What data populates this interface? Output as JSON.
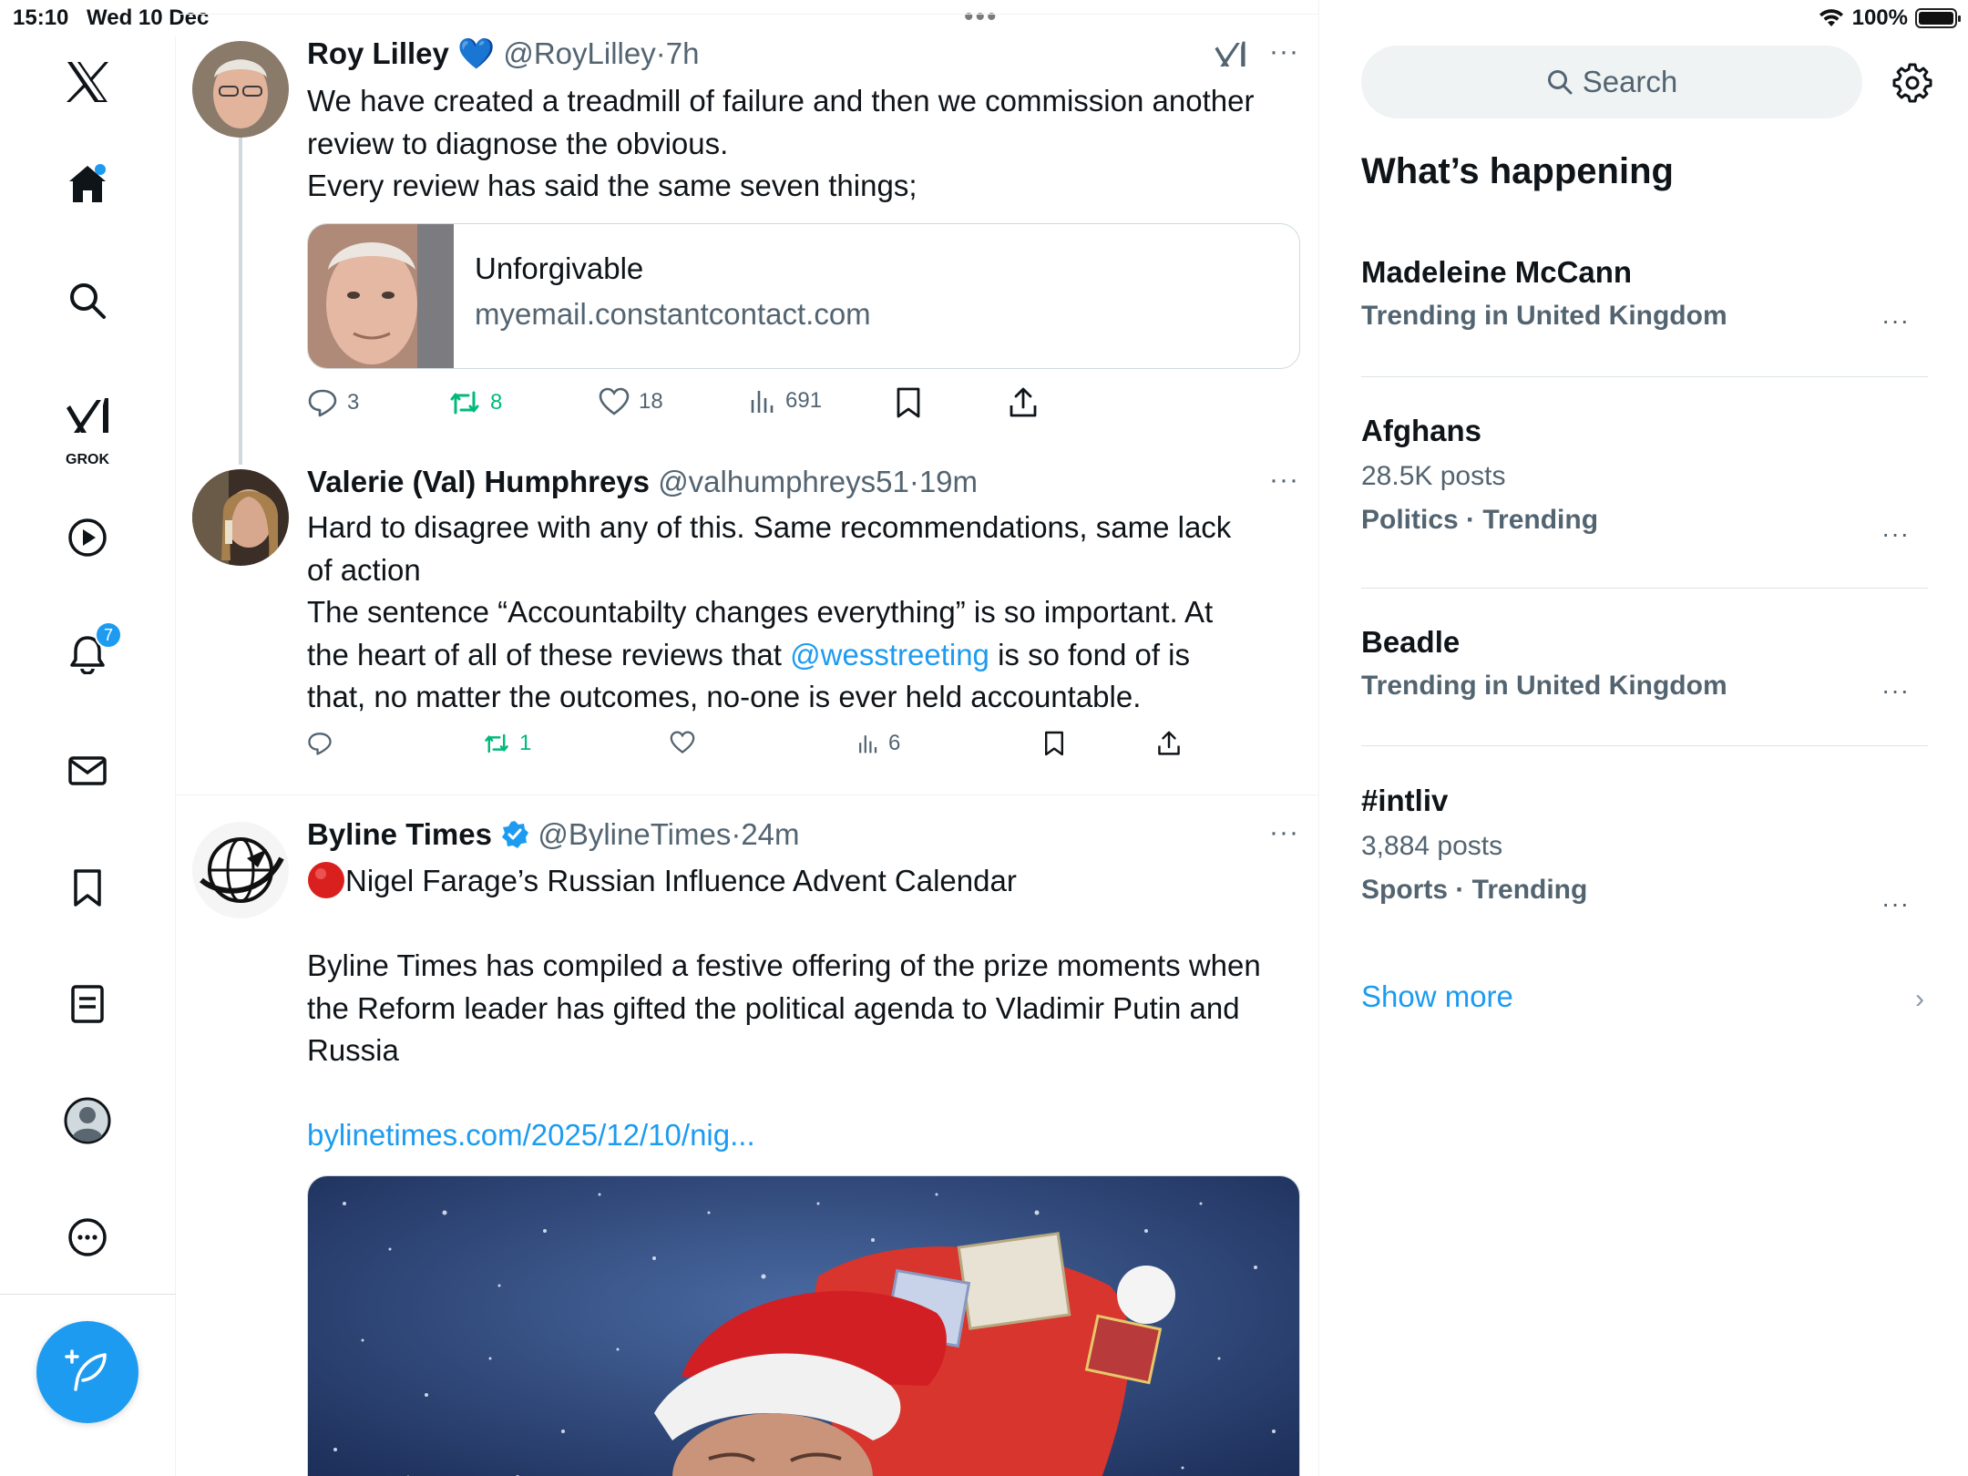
{
  "status_bar": {
    "time": "15:10",
    "date": "Wed 10 Dec",
    "battery": "100%",
    "multitask": "•••"
  },
  "nav": {
    "items": [
      "home",
      "explore",
      "grok",
      "video",
      "notifications",
      "messages",
      "bookmarks",
      "lists",
      "profile",
      "more"
    ],
    "grok_label": "GROK",
    "notifications_badge": "7"
  },
  "feed": {
    "tweets": [
      {
        "name": "Roy Lilley",
        "badge": "💙",
        "handle": "@RoyLilley",
        "dot": "·",
        "time": "7h",
        "more": "···",
        "text_lines": [
          "We have created a treadmill of failure and then we commission another",
          "review to diagnose the obvious.",
          "Every review has said the same seven things;"
        ],
        "card": {
          "title": "Unforgivable",
          "domain": "myemail.constantcontact.com"
        },
        "stats": {
          "replies": "3",
          "reposts": "8",
          "likes": "18",
          "views": "691"
        }
      },
      {
        "name": "Valerie (Val) Humphreys",
        "handle": "@valhumphreys51",
        "dot": "·",
        "time": "19m",
        "more": "···",
        "text_lines": [
          "Hard to disagree with any of this. Same recommendations, same lack",
          "of action",
          "The sentence “Accountabilty changes everything” is so important. At",
          "the heart of all of these reviews that ",
          "@wesstreeting",
          " is so fond of is",
          "that, no matter the outcomes, no-one is ever held accountable."
        ],
        "stats": {
          "replies": "",
          "reposts": "1",
          "likes": "",
          "views": "6"
        }
      },
      {
        "name": "Byline Times",
        "handle": "@BylineTimes",
        "dot": "·",
        "time": "24m",
        "more": "···",
        "headline": "Nigel Farage’s Russian Influence Advent Calendar",
        "text_lines": [
          "Byline Times has compiled a festive offering of the prize moments when",
          "the Reform leader has gifted the political agenda to Vladimir Putin and",
          "Russia"
        ],
        "link": "bylinetimes.com/2025/12/10/nig..."
      }
    ]
  },
  "sidebar": {
    "search_placeholder": "Search",
    "whats_happening": "What’s happening",
    "trends": [
      {
        "name": "Madeleine McCann",
        "posts": "",
        "context": "Trending in United Kingdom"
      },
      {
        "name": "Afghans",
        "posts": "28.5K posts",
        "context": "Politics · Trending"
      },
      {
        "name": "Beadle",
        "posts": "",
        "context": "Trending in United Kingdom"
      },
      {
        "name": "#intliv",
        "posts": "3,884 posts",
        "context": "Sports · Trending"
      }
    ],
    "trend_more": "···",
    "show_more": "Show more"
  },
  "colors": {
    "accent": "#1d9bf0",
    "repost_green": "#00ba7c",
    "muted": "#536471"
  }
}
